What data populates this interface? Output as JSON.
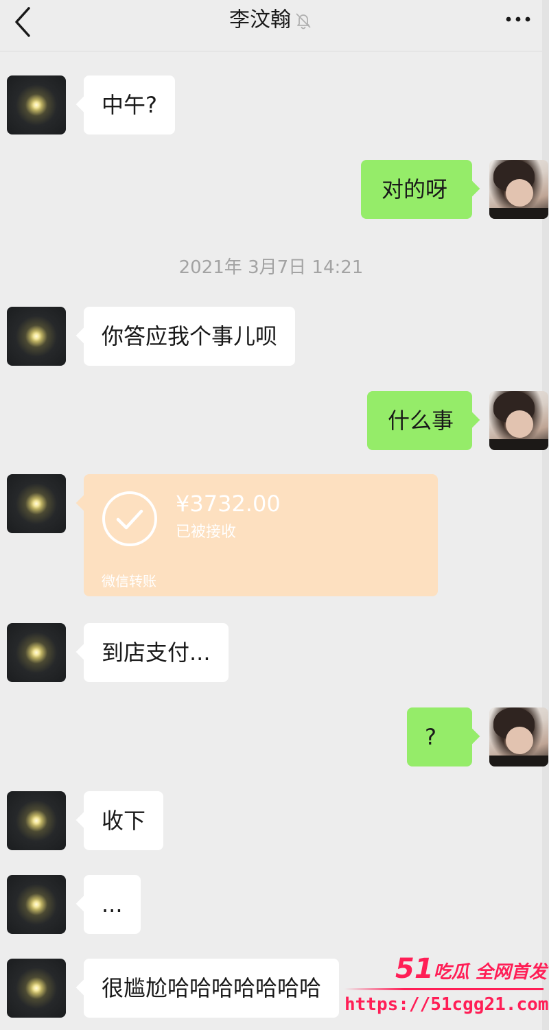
{
  "header": {
    "title": "李汶翰",
    "back_icon": "chevron-left-icon",
    "mute_icon": "bell-off-icon",
    "more_icon": "ellipsis-icon"
  },
  "messages": [
    {
      "side": "in",
      "text": "中午?"
    },
    {
      "side": "out",
      "text": "对的呀"
    },
    {
      "side": "in",
      "text": "你答应我个事儿呗"
    },
    {
      "side": "out",
      "text": "什么事"
    },
    {
      "side": "in",
      "text": "到店支付..."
    },
    {
      "side": "out",
      "text": "?"
    },
    {
      "side": "in",
      "text": "收下"
    },
    {
      "side": "in",
      "text": "..."
    },
    {
      "side": "in",
      "text": "很尴尬哈哈哈哈哈哈哈"
    }
  ],
  "timestamp": "2021年 3月7日 14:21",
  "transfer": {
    "amount": "¥3732.00",
    "status": "已被接收",
    "label": "微信转账",
    "icon": "check-circle-icon"
  },
  "watermark": {
    "brand_number": "51",
    "brand_text": "吃瓜 全网首发",
    "url": "https://51cgg21.com"
  },
  "colors": {
    "background": "#ededed",
    "incoming_bubble": "#ffffff",
    "outgoing_bubble": "#95ec69",
    "transfer_card": "#fde0c0",
    "timestamp_text": "#a3a3a3",
    "watermark": "#ff1e56"
  }
}
